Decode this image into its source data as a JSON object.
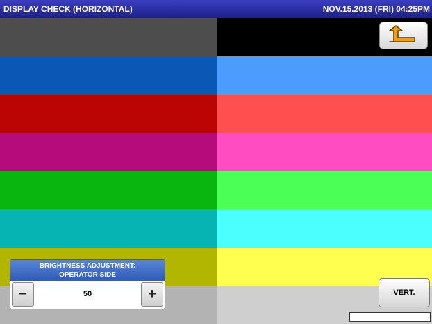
{
  "header": {
    "title": "DISPLAY CHECK (HORIZONTAL)",
    "datetime": "NOV.15.2013 (FRI)  04:25PM"
  },
  "color_rows": [
    {
      "left": "#4d4d4d",
      "right": "#000000"
    },
    {
      "left": "#0b57b5",
      "right": "#4c9bff"
    },
    {
      "left": "#bb0505",
      "right": "#ff4f4f"
    },
    {
      "left": "#b60b7b",
      "right": "#ff4cc1"
    },
    {
      "left": "#08b60f",
      "right": "#4cff56"
    },
    {
      "left": "#06b4b4",
      "right": "#4cffff"
    },
    {
      "left": "#b3b600",
      "right": "#ffff4f"
    },
    {
      "left": "#b3b3b3",
      "right": "#cfcfcf"
    }
  ],
  "back_button": {
    "icon": "return-arrow-icon"
  },
  "brightness": {
    "title_line1": "BRIGHTNESS ADJUSTMENT:",
    "title_line2": "OPERATOR SIDE",
    "minus_label": "−",
    "plus_label": "+",
    "value": "50"
  },
  "vert_button": {
    "label": "VERT."
  },
  "colors": {
    "header_bg": "#24279a",
    "brightness_header_bg": "#3a66c4",
    "button_bg": "#e8e8e8"
  }
}
